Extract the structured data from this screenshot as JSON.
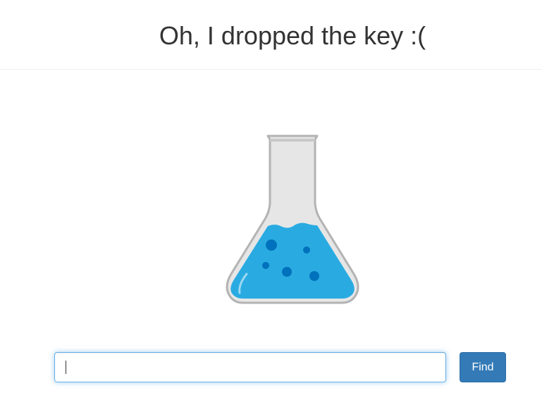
{
  "header": {
    "title": "Oh, I dropped the key :("
  },
  "illustration": {
    "icon": "flask-icon",
    "colors": {
      "liquid": "#29abe2",
      "bubbles": "#0071bc",
      "glass": "#e6e6e6",
      "glass_outline": "#b3b3b3"
    }
  },
  "search": {
    "value": "",
    "placeholder": "",
    "button_label": "Find",
    "button_color": "#337ab7",
    "focus_color": "#66afe9"
  }
}
